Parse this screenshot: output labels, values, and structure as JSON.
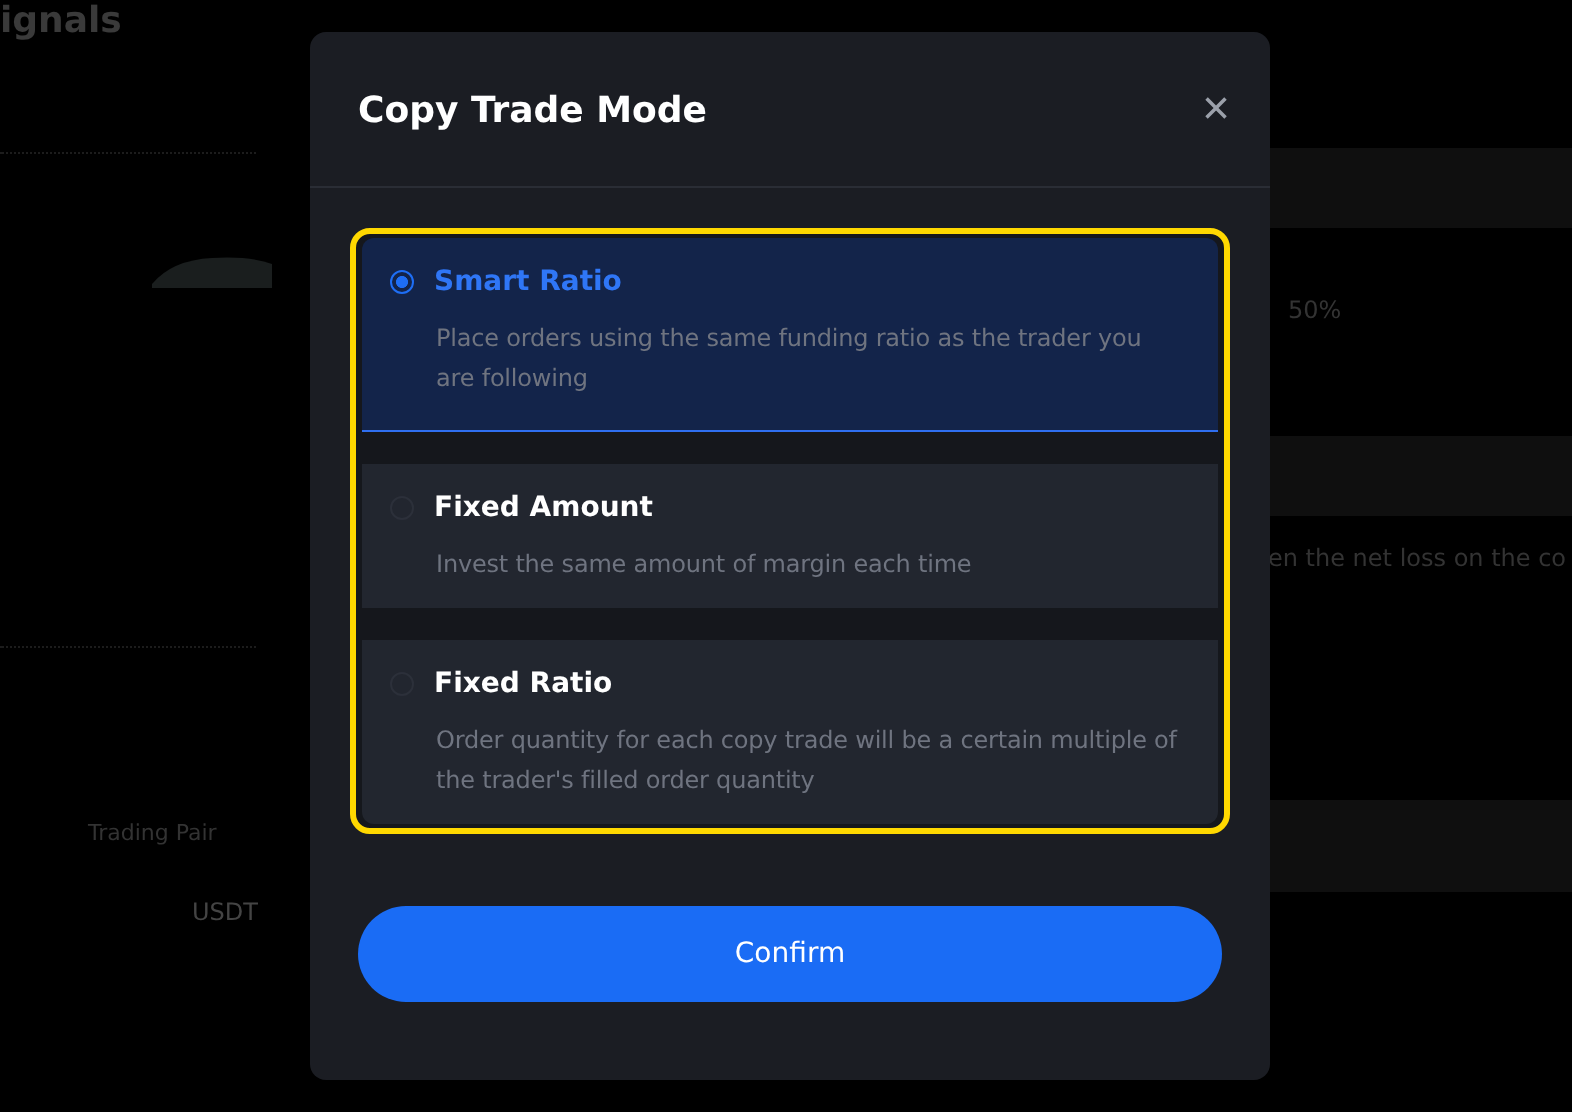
{
  "background": {
    "heading": "ignals",
    "percent": "50%",
    "note": "en the net loss on the co",
    "column_label": "Trading Pair",
    "pair": "USDT"
  },
  "dialog": {
    "title": "Copy Trade Mode",
    "close": "×",
    "options": [
      {
        "title": "Smart Ratio",
        "description": "Place orders using the same funding ratio as the trader you are following",
        "selected": true
      },
      {
        "title": "Fixed Amount",
        "description": "Invest the same amount of margin each time",
        "selected": false
      },
      {
        "title": "Fixed Ratio",
        "description": "Order quantity for each copy trade will be a certain multiple of the trader's filled order quantity",
        "selected": false
      }
    ],
    "confirm": "Confirm"
  }
}
